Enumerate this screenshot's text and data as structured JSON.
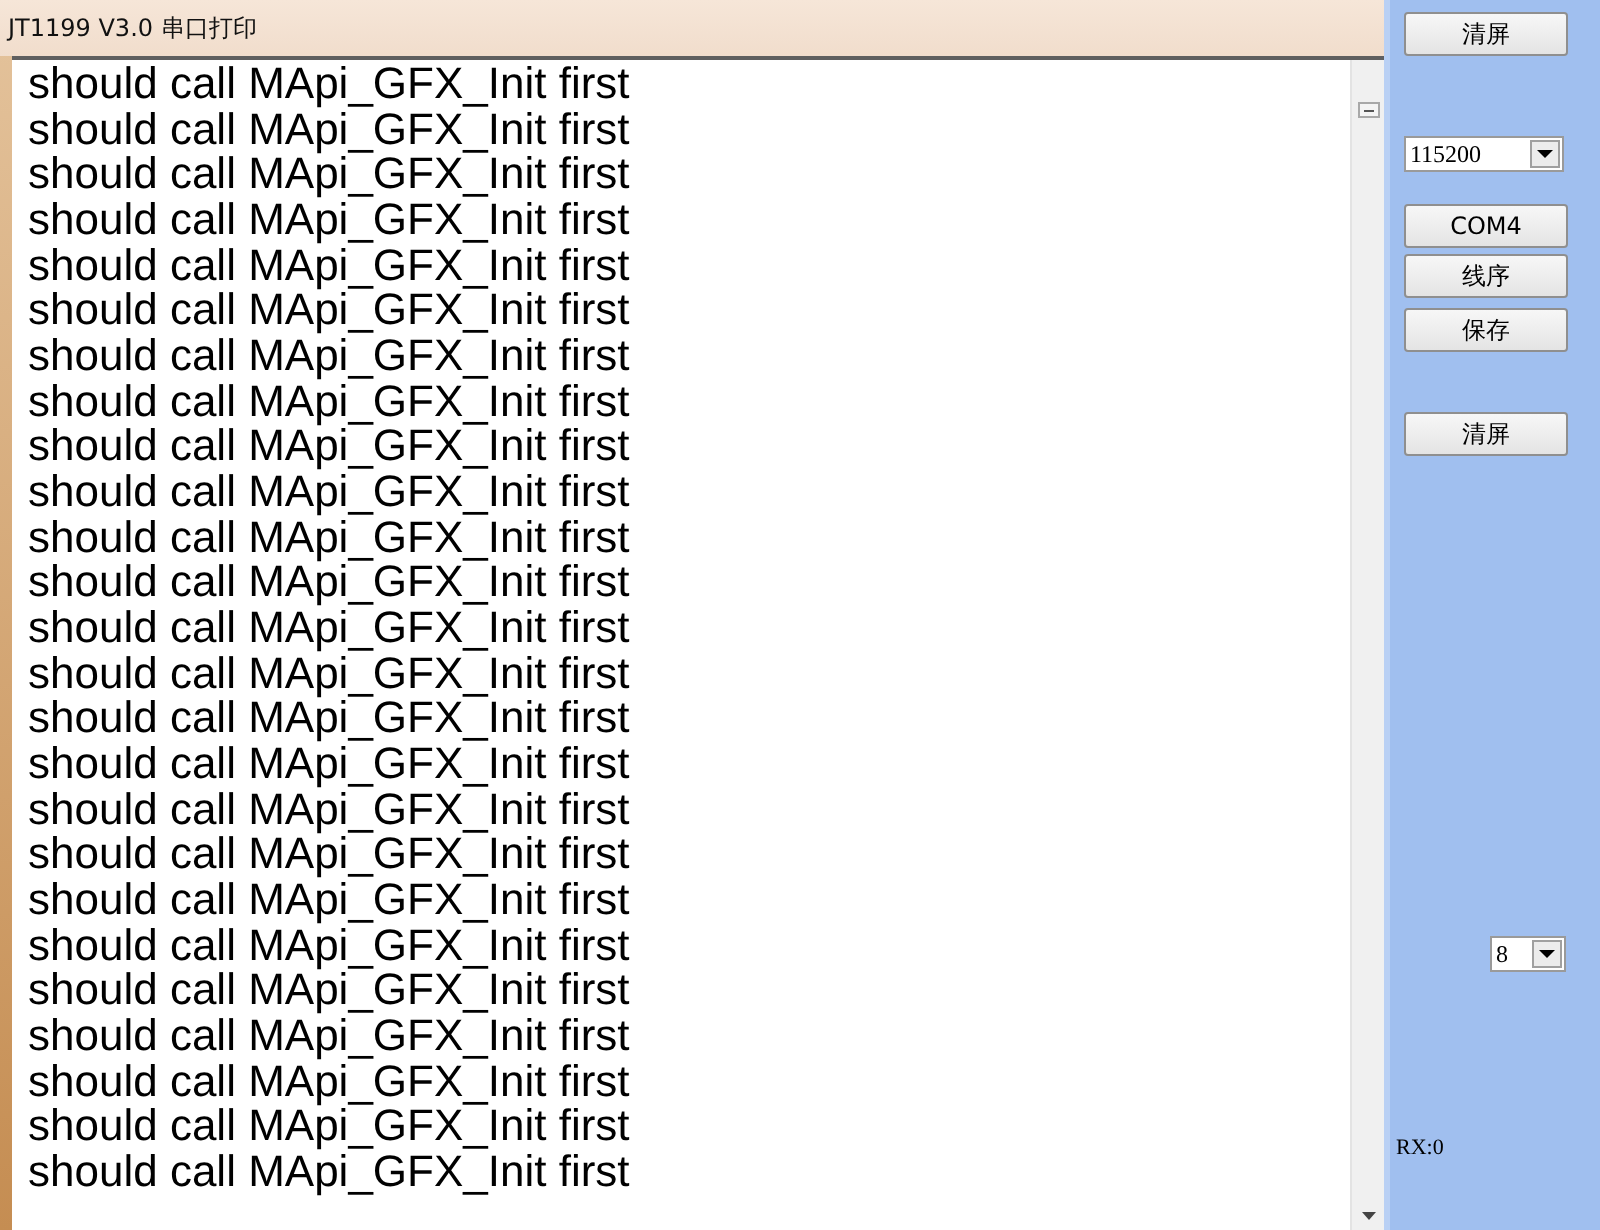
{
  "window": {
    "title": "JT1199 V3.0 串口打印"
  },
  "log": {
    "lines": [
      "should call MApi_GFX_Init first",
      "should call MApi_GFX_Init first",
      "should call MApi_GFX_Init first",
      "should call MApi_GFX_Init first",
      "should call MApi_GFX_Init first",
      "should call MApi_GFX_Init first",
      "should call MApi_GFX_Init first",
      "should call MApi_GFX_Init first",
      "should call MApi_GFX_Init first",
      "should call MApi_GFX_Init first",
      "should call MApi_GFX_Init first",
      "should call MApi_GFX_Init first",
      "should call MApi_GFX_Init first",
      "should call MApi_GFX_Init first",
      "should call MApi_GFX_Init first",
      "should call MApi_GFX_Init first",
      "should call MApi_GFX_Init first",
      "should call MApi_GFX_Init first",
      "should call MApi_GFX_Init first",
      "should call MApi_GFX_Init first",
      "should call MApi_GFX_Init first",
      "should call MApi_GFX_Init first",
      "should call MApi_GFX_Init first",
      "should call MApi_GFX_Init first",
      "should call MApi_GFX_Init first"
    ]
  },
  "side_panel": {
    "controls": [
      {
        "kind": "button",
        "label": "清屏"
      },
      {
        "kind": "dropdown",
        "value": "115200"
      },
      {
        "kind": "button",
        "label": "COM4"
      },
      {
        "kind": "button",
        "label": "线序"
      },
      {
        "kind": "button",
        "label": "保存"
      },
      {
        "kind": "button",
        "label": "清屏"
      },
      {
        "kind": "dropdown",
        "value": "8"
      },
      {
        "kind": "text",
        "text": "RX:0"
      }
    ]
  }
}
